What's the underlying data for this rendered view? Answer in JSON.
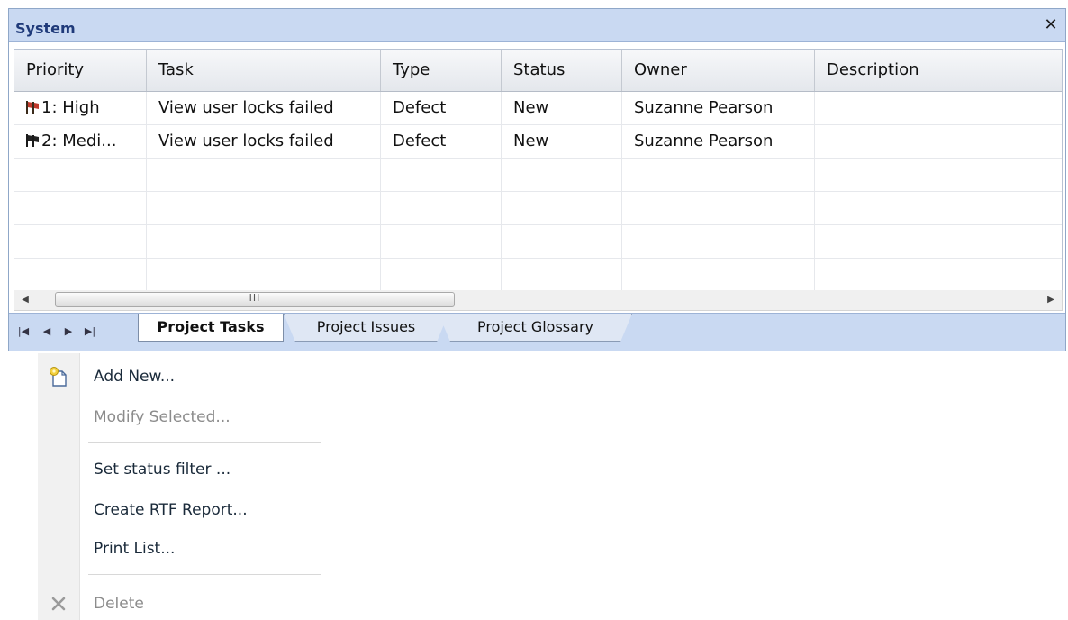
{
  "window": {
    "title": "System",
    "close_glyph": "✕"
  },
  "grid": {
    "columns": [
      "Priority",
      "Task",
      "Type",
      "Status",
      "Owner",
      "Description"
    ],
    "rows": [
      {
        "priority": "1: High",
        "priority_flag_color": "#c0392b",
        "task": "View user locks failed",
        "type": "Defect",
        "status": "New",
        "owner": "Suzanne Pearson",
        "description": ""
      },
      {
        "priority": "2: Medi...",
        "priority_flag_color": "#222222",
        "task": "View user locks failed",
        "type": "Defect",
        "status": "New",
        "owner": "Suzanne Pearson",
        "description": ""
      }
    ]
  },
  "scrollbar": {
    "left_arrow": "◀",
    "right_arrow": "▶",
    "grip": "III"
  },
  "tabs": {
    "nav": [
      "|◀",
      "◀",
      "▶",
      "▶|"
    ],
    "items": [
      {
        "label": "Project Tasks",
        "active": true
      },
      {
        "label": "Project Issues",
        "active": false
      },
      {
        "label": "Project Glossary",
        "active": false
      }
    ]
  },
  "menu": {
    "items": [
      {
        "label": "Add New...",
        "enabled": true,
        "icon": "new-item-icon"
      },
      {
        "label": "Modify Selected...",
        "enabled": false
      },
      {
        "label": "Set status filter ...",
        "enabled": true
      },
      {
        "label": "Create RTF Report...",
        "enabled": true
      },
      {
        "label": "Print List...",
        "enabled": true
      },
      {
        "label": "Delete",
        "enabled": false,
        "icon": "delete-icon"
      }
    ]
  }
}
